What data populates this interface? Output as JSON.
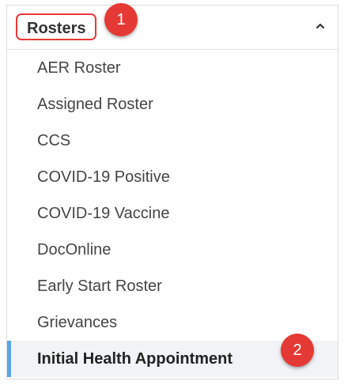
{
  "menu": {
    "header_label": "Rosters",
    "items": [
      {
        "label": "AER Roster",
        "active": false
      },
      {
        "label": "Assigned Roster",
        "active": false
      },
      {
        "label": "CCS",
        "active": false
      },
      {
        "label": "COVID-19 Positive",
        "active": false
      },
      {
        "label": "COVID-19 Vaccine",
        "active": false
      },
      {
        "label": "DocOnline",
        "active": false
      },
      {
        "label": "Early Start Roster",
        "active": false
      },
      {
        "label": "Grievances",
        "active": false
      },
      {
        "label": "Initial Health Appointment",
        "active": true
      }
    ]
  },
  "callouts": {
    "step1": "1",
    "step2": "2"
  },
  "icons": {
    "collapse": "chevron-up-icon"
  },
  "colors": {
    "highlight_border": "#e8393a",
    "badge": "#e53935",
    "active_indicator": "#5aa7e6",
    "active_background": "#f1f3f6"
  }
}
